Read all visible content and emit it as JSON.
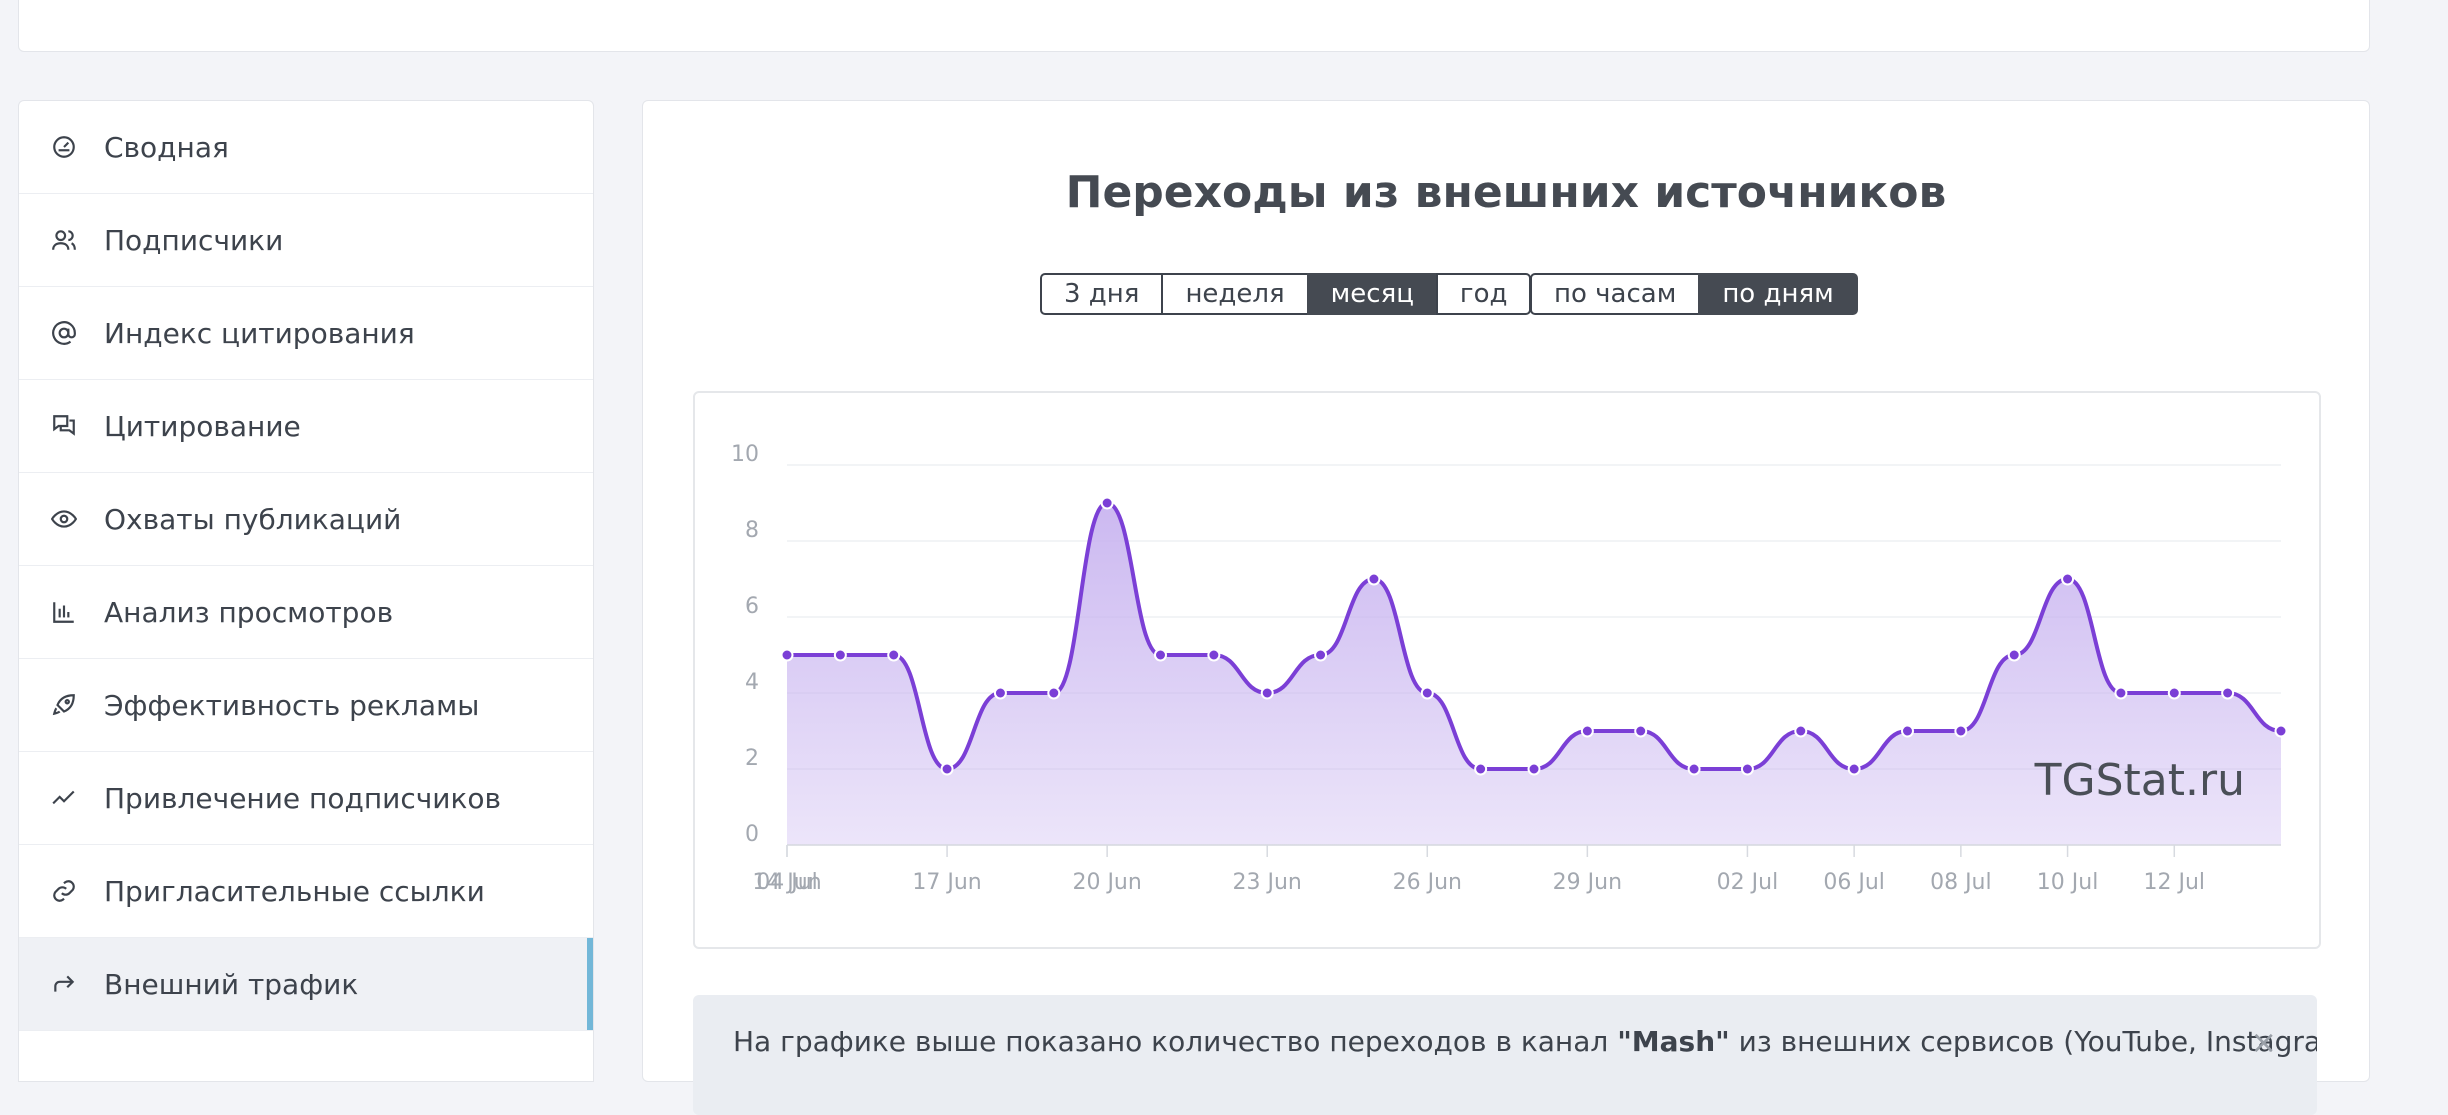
{
  "sidebar": {
    "items": [
      {
        "label": "Сводная",
        "icon": "dashboard-icon"
      },
      {
        "label": "Подписчики",
        "icon": "users-icon"
      },
      {
        "label": "Индекс цитирования",
        "icon": "at-sign-icon"
      },
      {
        "label": "Цитирование",
        "icon": "chat-bubbles-icon"
      },
      {
        "label": "Охваты публикаций",
        "icon": "eye-icon"
      },
      {
        "label": "Анализ просмотров",
        "icon": "bar-chart-icon"
      },
      {
        "label": "Эффективность рекламы",
        "icon": "rocket-icon"
      },
      {
        "label": "Привлечение подписчиков",
        "icon": "trend-line-icon"
      },
      {
        "label": "Пригласительные ссылки",
        "icon": "link-icon"
      },
      {
        "label": "Внешний трафик",
        "icon": "share-arrow-icon",
        "active": true
      }
    ]
  },
  "main": {
    "title": "Переходы из внешних источников",
    "period_buttons": [
      "3 дня",
      "неделя",
      "месяц",
      "год"
    ],
    "period_active": "месяц",
    "granularity_buttons": [
      "по часам",
      "по дням"
    ],
    "granularity_active": "по дням",
    "watermark": "TGStat.ru",
    "notice": {
      "text_before": "На графике выше показано количество переходов в канал ",
      "channel": "\"Mash\"",
      "text_after": " из внешних сервисов (YouTube, Instagram,",
      "close": "×"
    }
  },
  "colors": {
    "line": "#7b3fd6",
    "fill": "#c9b5f0",
    "active_tab_marker": "#72b7d8",
    "active_button": "#454a52"
  },
  "chart_data": {
    "type": "area",
    "x": [
      "14 Jun",
      "15 Jun",
      "16 Jun",
      "17 Jun",
      "18 Jun",
      "19 Jun",
      "20 Jun",
      "21 Jun",
      "22 Jun",
      "23 Jun",
      "24 Jun",
      "25 Jun",
      "26 Jun",
      "27 Jun",
      "28 Jun",
      "29 Jun",
      "30 Jun",
      "01 Jul",
      "02 Jul",
      "03 Jul",
      "06 Jul",
      "07 Jul",
      "08 Jul",
      "09 Jul",
      "10 Jul",
      "11 Jul",
      "12 Jul",
      "13 Jul",
      "14 Jul"
    ],
    "y": [
      5,
      5,
      5,
      2,
      4,
      4,
      9,
      5,
      5,
      4,
      5,
      7,
      4,
      2,
      2,
      3,
      3,
      2,
      2,
      3,
      2,
      3,
      3,
      5,
      7,
      4,
      4,
      4,
      3
    ],
    "x_ticks": [
      "14 Jun",
      "17 Jun",
      "20 Jun",
      "23 Jun",
      "26 Jun",
      "29 Jun",
      "02 Jul",
      "04 Jul",
      "06 Jul",
      "08 Jul",
      "10 Jul",
      "12 Jul"
    ],
    "y_ticks": [
      0,
      2,
      4,
      6,
      8,
      10
    ],
    "ylim": [
      0,
      10
    ],
    "grid": true,
    "legend": "none"
  }
}
